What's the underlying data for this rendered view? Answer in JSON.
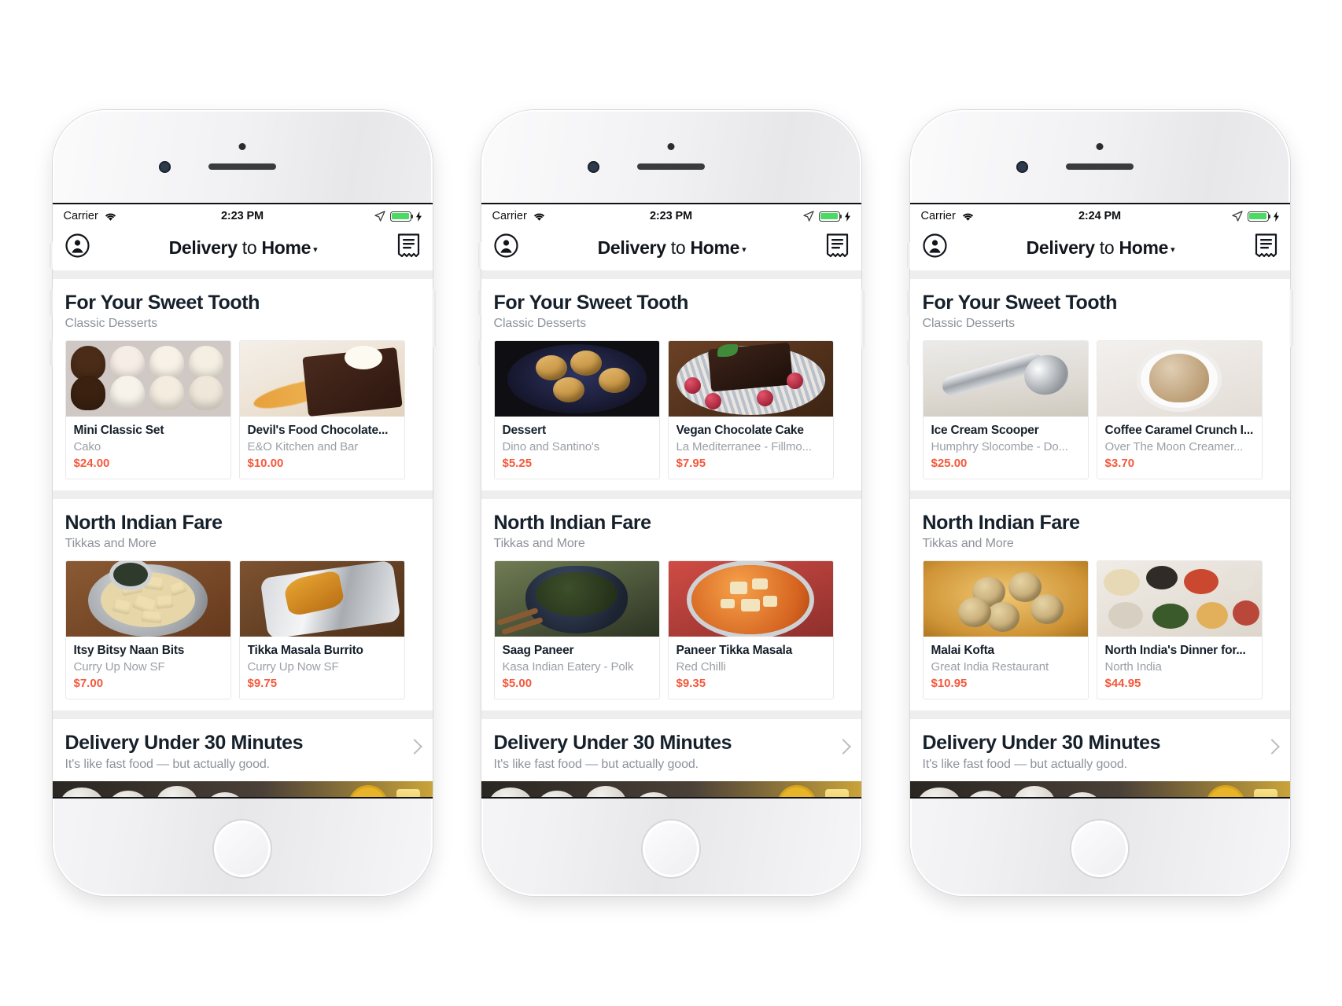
{
  "app": {
    "nav": {
      "title_bold_1": "Delivery",
      "title_light": " to ",
      "title_bold_2": "Home",
      "caret": "▾",
      "profile_icon": "account-circle-icon",
      "orders_icon": "receipt-list-icon"
    },
    "status": {
      "carrier": "Carrier",
      "wifi_icon": "wifi-icon",
      "location_icon": "location-arrow-icon",
      "battery_icon": "battery-charging-icon",
      "bolt": "⚡"
    },
    "promo": {
      "title": "Delivery Under 30 Minutes",
      "subtitle": "It's like fast food — but actually good.",
      "chevron_icon": "chevron-right-icon"
    },
    "colors": {
      "price": "#f4593c",
      "heading": "#16202b",
      "muted": "#9b9fa6",
      "battery_green": "#4cd964"
    }
  },
  "phones": [
    {
      "time": "2:23 PM",
      "sections": [
        {
          "title": "For Your Sweet Tooth",
          "subtitle": "Classic Desserts",
          "cards": [
            {
              "name": "Mini Classic Set",
              "restaurant": "Cako",
              "price": "$24.00",
              "photo": "cupcakes"
            },
            {
              "name": "Devil's Food Chocolate...",
              "restaurant": "E&O Kitchen and Bar",
              "price": "$10.00",
              "photo": "devils"
            }
          ]
        },
        {
          "title": "North Indian Fare",
          "subtitle": "Tikkas and More",
          "cards": [
            {
              "name": "Itsy Bitsy Naan Bits",
              "restaurant": "Curry Up Now SF",
              "price": "$7.00",
              "photo": "naan"
            },
            {
              "name": "Tikka Masala Burrito",
              "restaurant": "Curry Up Now SF",
              "price": "$9.75",
              "photo": "burrito"
            }
          ]
        }
      ]
    },
    {
      "time": "2:23 PM",
      "sections": [
        {
          "title": "For Your Sweet Tooth",
          "subtitle": "Classic Desserts",
          "cards": [
            {
              "name": "Dessert",
              "restaurant": "Dino and Santino's",
              "price": "$5.25",
              "photo": "dessert"
            },
            {
              "name": "Vegan Chocolate Cake",
              "restaurant": "La Mediterranee - Fillmo...",
              "price": "$7.95",
              "photo": "vegan"
            }
          ]
        },
        {
          "title": "North Indian Fare",
          "subtitle": "Tikkas and More",
          "cards": [
            {
              "name": "Saag Paneer",
              "restaurant": "Kasa Indian Eatery - Polk",
              "price": "$5.00",
              "photo": "saag"
            },
            {
              "name": "Paneer Tikka Masala",
              "restaurant": "Red Chilli",
              "price": "$9.35",
              "photo": "tikka"
            }
          ]
        }
      ]
    },
    {
      "time": "2:24 PM",
      "sections": [
        {
          "title": "For Your Sweet Tooth",
          "subtitle": "Classic Desserts",
          "cards": [
            {
              "name": "Ice Cream Scooper",
              "restaurant": "Humphry Slocombe - Do...",
              "price": "$25.00",
              "photo": "scooper"
            },
            {
              "name": "Coffee Caramel Crunch I...",
              "restaurant": "Over The Moon Creamer...",
              "price": "$3.70",
              "photo": "coffee"
            }
          ]
        },
        {
          "title": "North Indian Fare",
          "subtitle": "Tikkas and More",
          "cards": [
            {
              "name": "Malai Kofta",
              "restaurant": "Great India Restaurant",
              "price": "$10.95",
              "photo": "malai"
            },
            {
              "name": "North India's Dinner for...",
              "restaurant": "North India",
              "price": "$44.95",
              "photo": "spread"
            }
          ]
        }
      ]
    }
  ]
}
